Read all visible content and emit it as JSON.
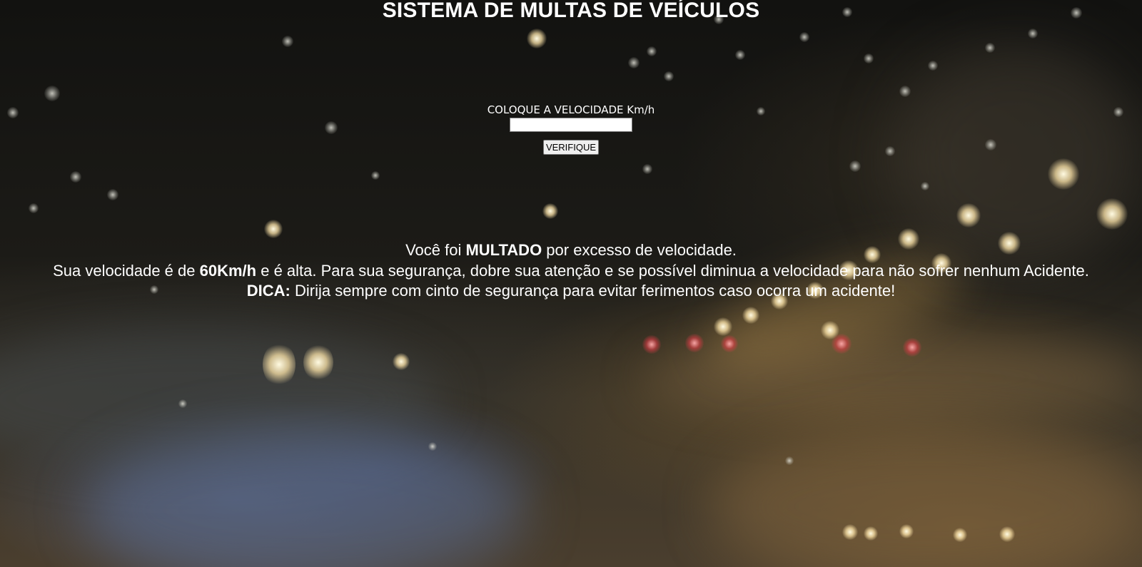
{
  "page": {
    "title": "SISTEMA DE MULTAS DE VEÍCULOS"
  },
  "form": {
    "speed_label": "COLOQUE A VELOCIDADE Km/h",
    "speed_value": "",
    "verify_label": "VERIFIQUE"
  },
  "result": {
    "line1_prefix": "Você foi ",
    "line1_strong": "MULTADO",
    "line1_suffix": " por excesso de velocidade.",
    "line2_prefix": "Sua velocidade é de ",
    "line2_strong": "60Km/h",
    "line2_suffix": " e é alta. Para sua segurança, dobre sua atenção e se possível diminua a velocidade para não sofrer nenhum Acidente.",
    "tip_label": "DICA:",
    "tip_text": " Dirija sempre com cinto de segurança para evitar ferimentos caso ocorra um acidente!"
  },
  "colors": {
    "text": "#ffffff",
    "button_bg": "#efefef"
  }
}
